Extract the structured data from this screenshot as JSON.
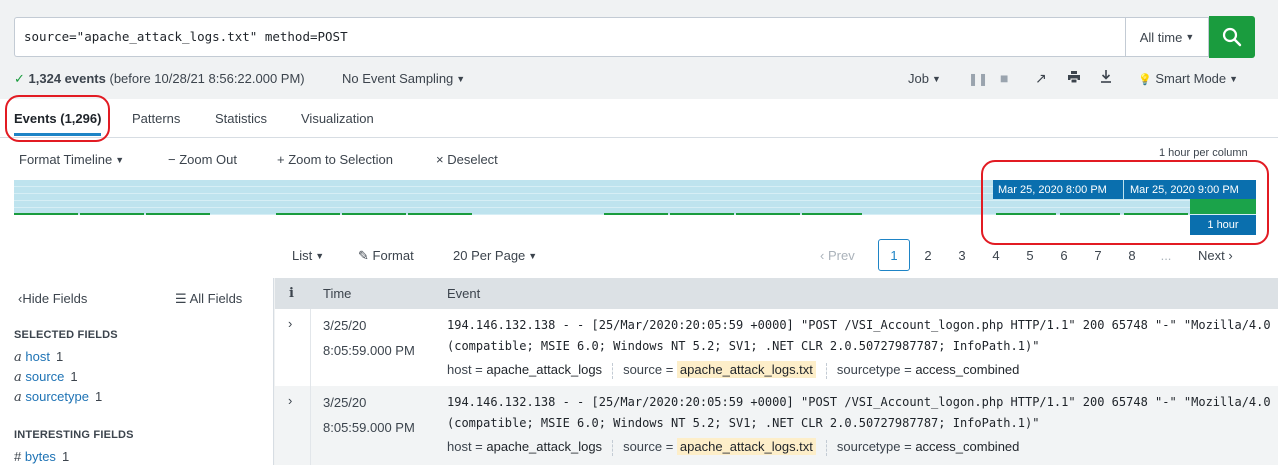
{
  "search": {
    "query": "source=\"apache_attack_logs.txt\" method=POST",
    "time_range": "All time"
  },
  "meta": {
    "events_count": "1,324 events",
    "events_note": "(before 10/28/21 8:56:22.000 PM)",
    "sampling": "No Event Sampling",
    "job": "Job",
    "mode": "Smart Mode"
  },
  "tabs": [
    {
      "label": "Events (1,296)"
    },
    {
      "label": "Patterns"
    },
    {
      "label": "Statistics"
    },
    {
      "label": "Visualization"
    }
  ],
  "timeline": {
    "format": "Format Timeline",
    "zoom_out": "Zoom Out",
    "zoom_selection": "Zoom to Selection",
    "deselect": "Deselect",
    "scale": "1 hour per column",
    "col1": "Mar 25, 2020 8:00 PM",
    "col2": "Mar 25, 2020 9:00 PM",
    "span": "1 hour"
  },
  "listctl": {
    "list": "List",
    "format": "Format",
    "per_page": "20 Per Page"
  },
  "pagination": {
    "prev": "Prev",
    "pages": [
      "1",
      "2",
      "3",
      "4",
      "5",
      "6",
      "7",
      "8",
      "..."
    ],
    "next": "Next"
  },
  "sidebar": {
    "hide_fields": "Hide Fields",
    "all_fields": "All Fields",
    "selected_heading": "SELECTED FIELDS",
    "selected": [
      {
        "type": "a",
        "name": "host",
        "count": "1"
      },
      {
        "type": "a",
        "name": "source",
        "count": "1"
      },
      {
        "type": "a",
        "name": "sourcetype",
        "count": "1"
      }
    ],
    "interesting_heading": "INTERESTING FIELDS",
    "interesting": [
      {
        "type": "#",
        "name": "bytes",
        "count": "1"
      }
    ]
  },
  "table": {
    "col_info": "i",
    "col_time": "Time",
    "col_event": "Event",
    "rows": [
      {
        "date": "3/25/20",
        "time": "8:05:59.000 PM",
        "raw1": "194.146.132.138 - - [25/Mar/2020:20:05:59 +0000] \"POST /VSI_Account_logon.php HTTP/1.1\" 200 65748 \"-\" \"Mozilla/4.0",
        "raw2": "(compatible; MSIE 6.0; Windows NT 5.2; SV1; .NET CLR 2.0.50727987787; InfoPath.1)\"",
        "host_label": "host =",
        "host": "apache_attack_logs",
        "source_label": "source =",
        "source": "apache_attack_logs.txt",
        "sourcetype_label": "sourcetype =",
        "sourcetype": "access_combined"
      },
      {
        "date": "3/25/20",
        "time": "8:05:59.000 PM",
        "raw1": "194.146.132.138 - - [25/Mar/2020:20:05:59 +0000] \"POST /VSI_Account_logon.php HTTP/1.1\" 200 65748 \"-\" \"Mozilla/4.0",
        "raw2": "(compatible; MSIE 6.0; Windows NT 5.2; SV1; .NET CLR 2.0.50727987787; InfoPath.1)\"",
        "host_label": "host =",
        "host": "apache_attack_logs",
        "source_label": "source =",
        "source": "apache_attack_logs.txt",
        "sourcetype_label": "sourcetype =",
        "sourcetype": "access_combined"
      }
    ]
  },
  "colors": {
    "accent": "#1e84c6",
    "search_button": "#1a9c3e",
    "annotation": "#e21b23",
    "timeline_selected": "#0a6fae"
  }
}
